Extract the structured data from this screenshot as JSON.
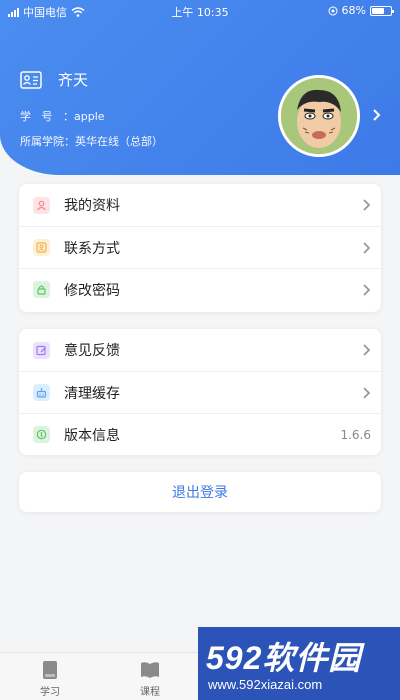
{
  "status_bar": {
    "carrier": "中国电信",
    "time": "上午 10:35",
    "battery": "68%",
    "battery_level": 0.68
  },
  "profile": {
    "name": "齐天",
    "student_id_label": "学号：",
    "student_id_label_a": "学",
    "student_id_label_b": "号：",
    "student_id": "apple",
    "college_label": "所属学院：",
    "college": "英华在线（总部）"
  },
  "menu_group_1": [
    {
      "label": "我的资料",
      "icon": "profile-icon",
      "color": "#f08a8a"
    },
    {
      "label": "联系方式",
      "icon": "contact-icon",
      "color": "#f2b24a"
    },
    {
      "label": "修改密码",
      "icon": "lock-icon",
      "color": "#5cc46a"
    }
  ],
  "menu_group_2": [
    {
      "label": "意见反馈",
      "icon": "feedback-icon",
      "color": "#9b7cf2"
    },
    {
      "label": "清理缓存",
      "icon": "clean-icon",
      "color": "#5aa7ef"
    },
    {
      "label": "版本信息",
      "icon": "info-icon",
      "color": "#5cc46a",
      "value": "1.6.6"
    }
  ],
  "logout_label": "退出登录",
  "tabbar": {
    "tab_study": "学习",
    "tab_course": "课程"
  },
  "watermark": {
    "brand": "592软件园",
    "url": "www.592xiazai.com"
  },
  "colors": {
    "primary": "#3d7ae8",
    "header_gradient_start": "#4b8df0"
  }
}
